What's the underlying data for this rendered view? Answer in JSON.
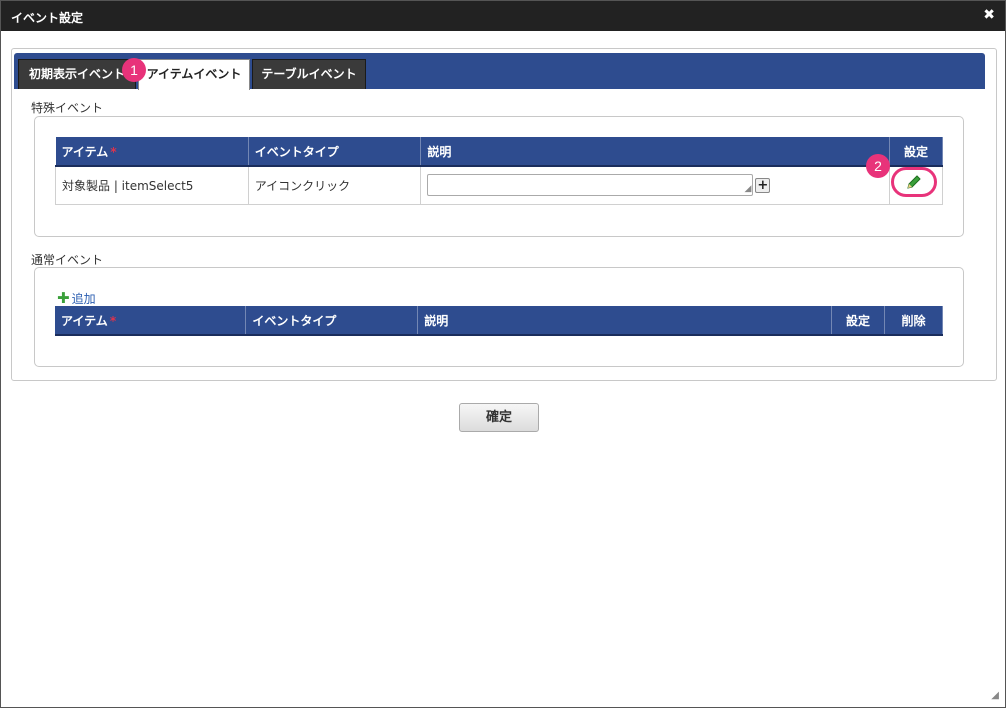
{
  "dialog": {
    "title": "イベント設定",
    "close_glyph": "✖"
  },
  "tabs": [
    {
      "label": "初期表示イベント",
      "active": false
    },
    {
      "label": "アイテムイベント",
      "active": true
    },
    {
      "label": "テーブルイベント",
      "active": false
    }
  ],
  "badges": [
    "1",
    "2"
  ],
  "special_events": {
    "section_label": "特殊イベント",
    "columns": [
      "アイテム",
      "イベントタイプ",
      "説明",
      "設定"
    ],
    "required_mark": "*",
    "rows": [
      {
        "item": "対象製品 | itemSelect5",
        "event_type": "アイコンクリック",
        "description": ""
      }
    ]
  },
  "normal_events": {
    "section_label": "通常イベント",
    "add_label": "追加",
    "columns": [
      "アイテム",
      "イベントタイプ",
      "説明",
      "設定",
      "削除"
    ],
    "required_mark": "*"
  },
  "buttons": {
    "ok_label": "確定",
    "plus_glyph": "+"
  },
  "colors": {
    "header_blue": "#2e4c8f",
    "badge_pink": "#e8337a",
    "titlebar": "#222222"
  }
}
